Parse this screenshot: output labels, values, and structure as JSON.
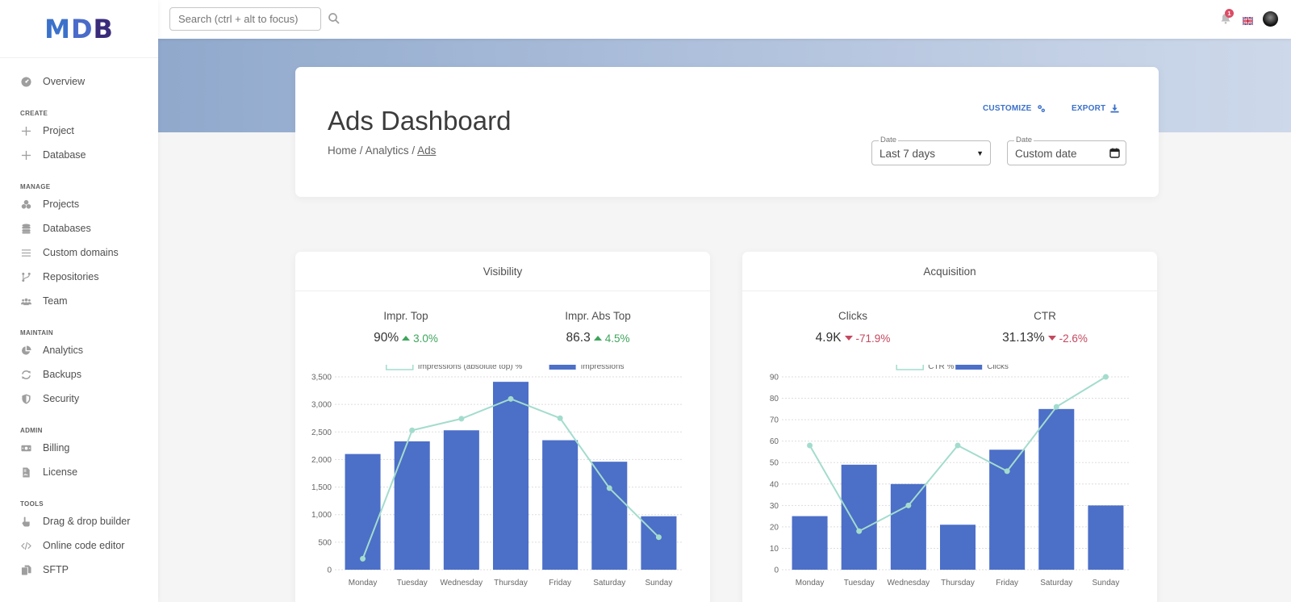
{
  "logo": {
    "letters": [
      "M",
      "D",
      "B"
    ]
  },
  "topbar": {
    "search_placeholder": "Search (ctrl + alt to focus)",
    "notification_count": "1"
  },
  "sidebar": {
    "top_items": [
      {
        "label": "Overview",
        "icon": "gauge-icon"
      }
    ],
    "sections": [
      {
        "title": "CREATE",
        "items": [
          {
            "label": "Project",
            "icon": "plus-icon"
          },
          {
            "label": "Database",
            "icon": "plus-icon"
          }
        ]
      },
      {
        "title": "MANAGE",
        "items": [
          {
            "label": "Projects",
            "icon": "cubes-icon"
          },
          {
            "label": "Databases",
            "icon": "database-icon"
          },
          {
            "label": "Custom domains",
            "icon": "bars-icon"
          },
          {
            "label": "Repositories",
            "icon": "code-branch-icon"
          },
          {
            "label": "Team",
            "icon": "users-icon"
          }
        ]
      },
      {
        "title": "MAINTAIN",
        "items": [
          {
            "label": "Analytics",
            "icon": "chart-pie-icon"
          },
          {
            "label": "Backups",
            "icon": "sync-icon"
          },
          {
            "label": "Security",
            "icon": "shield-icon"
          }
        ]
      },
      {
        "title": "ADMIN",
        "items": [
          {
            "label": "Billing",
            "icon": "money-bill-icon"
          },
          {
            "label": "License",
            "icon": "file-contract-icon"
          }
        ]
      },
      {
        "title": "TOOLS",
        "items": [
          {
            "label": "Drag & drop builder",
            "icon": "hand-pointer-icon"
          },
          {
            "label": "Online code editor",
            "icon": "code-icon"
          },
          {
            "label": "SFTP",
            "icon": "copy-icon"
          }
        ]
      }
    ]
  },
  "header": {
    "title": "Ads Dashboard",
    "breadcrumb": [
      "Home",
      "Analytics",
      "Ads"
    ],
    "separator": "/",
    "customize_label": "CUSTOMIZE",
    "export_label": "EXPORT",
    "date_select": {
      "label": "Date",
      "value": "Last 7 days"
    },
    "date_custom": {
      "label": "Date",
      "value": "Custom date"
    }
  },
  "colors": {
    "accent": "#3b71ca",
    "bar": "#4c6fc8",
    "line": "#a3dccd",
    "positive": "#3ea55c",
    "negative": "#c4485e"
  },
  "cards": [
    {
      "title": "Visibility",
      "stats": [
        {
          "label": "Impr. Top",
          "value": "90%",
          "change": "3.0%",
          "trend": "up"
        },
        {
          "label": "Impr. Abs Top",
          "value": "86.3",
          "change": "4.5%",
          "trend": "up"
        }
      ]
    },
    {
      "title": "Acquisition",
      "stats": [
        {
          "label": "Clicks",
          "value": "4.9K",
          "change": "-71.9%",
          "trend": "down"
        },
        {
          "label": "CTR",
          "value": "31.13%",
          "change": "-2.6%",
          "trend": "down"
        }
      ]
    }
  ],
  "chart_data": [
    {
      "type": "bar",
      "title": "Visibility",
      "categories": [
        "Monday",
        "Tuesday",
        "Wednesday",
        "Thursday",
        "Friday",
        "Saturday",
        "Sunday"
      ],
      "series": [
        {
          "name": "Impressions (absolute top) %",
          "type": "line",
          "values": [
            200,
            2530,
            2740,
            3100,
            2750,
            1480,
            590
          ]
        },
        {
          "name": "Impressions",
          "type": "bar",
          "values": [
            2100,
            2330,
            2530,
            3410,
            2350,
            1960,
            970
          ]
        }
      ],
      "yticks": [
        "0",
        "500",
        "1,000",
        "1,500",
        "2,000",
        "2,500",
        "3,000",
        "3,500"
      ],
      "ylim": [
        0,
        3500
      ],
      "grid": true,
      "legend": "top-center"
    },
    {
      "type": "bar",
      "title": "Acquisition",
      "categories": [
        "Monday",
        "Tuesday",
        "Wednesday",
        "Thursday",
        "Friday",
        "Saturday",
        "Sunday"
      ],
      "series": [
        {
          "name": "CTR %",
          "type": "line",
          "values": [
            58,
            18,
            30,
            58,
            46,
            76,
            90
          ]
        },
        {
          "name": "Clicks",
          "type": "bar",
          "values": [
            25,
            49,
            40,
            21,
            56,
            75,
            30
          ]
        }
      ],
      "yticks": [
        "0",
        "10",
        "20",
        "30",
        "40",
        "50",
        "60",
        "70",
        "80",
        "90"
      ],
      "ylim": [
        0,
        90
      ],
      "grid": true,
      "legend": "top-center"
    }
  ]
}
